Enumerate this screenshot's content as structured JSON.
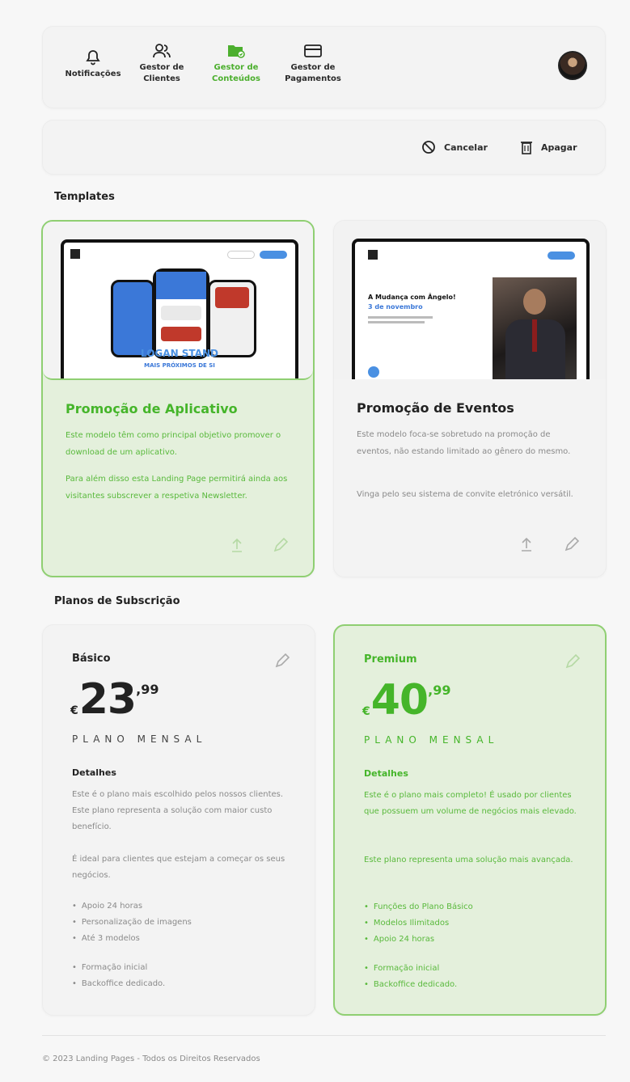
{
  "nav": {
    "items": [
      {
        "label_1": "Notificações",
        "label_2": "",
        "icon": "bell-icon"
      },
      {
        "label_1": "Gestor de",
        "label_2": "Clientes",
        "icon": "users-icon"
      },
      {
        "label_1": "Gestor de",
        "label_2": "Conteúdos",
        "icon": "folder-icon",
        "active": true
      },
      {
        "label_1": "Gestor de",
        "label_2": "Pagamentos",
        "icon": "card-icon"
      }
    ],
    "active_color": "#4caf2e"
  },
  "actions": {
    "cancel": "Cancelar",
    "delete": "Apagar"
  },
  "templates": {
    "title": "Templates",
    "items": [
      {
        "title": "Promoção de Aplicativo",
        "p1": "Este modelo têm como principal objetivo promover o download de um aplicativo.",
        "p2": "Para além disso esta Landing Page permitirá ainda aos visitantes subscrever a respetiva Newsletter.",
        "preview_headline": "LOGAN STAND",
        "preview_sub": "MAIS PRÓXIMOS DE SI",
        "selected": true
      },
      {
        "title": "Promoção de Eventos",
        "p1": "Este modelo foca-se sobretudo na promoção de eventos, não estando limitado ao gênero do mesmo.",
        "p2": "Vinga pelo seu sistema de convite eletrónico versátil.",
        "preview_headline": "A Mudança com Ângelo!",
        "preview_sub": "3 de novembro",
        "selected": false
      }
    ]
  },
  "plans": {
    "title": "Planos de Subscrição",
    "items": [
      {
        "name": "Básico",
        "currency": "€",
        "amount": "23",
        "cents": ",99",
        "period": "PLANO MENSAL",
        "details_title": "Detalhes",
        "p1": "Este é o plano mais escolhido pelos nossos clientes. Este plano representa a solução com maior custo benefício.",
        "p2": "É ideal para clientes que estejam a começar os seus negócios.",
        "features_a": [
          "Apoio 24 horas",
          "Personalização de imagens",
          "Até 3 modelos"
        ],
        "features_b": [
          "Formação inicial",
          "Backoffice dedicado."
        ],
        "selected": false
      },
      {
        "name": "Premium",
        "currency": "€",
        "amount": "40",
        "cents": ",99",
        "period": "PLANO MENSAL",
        "details_title": "Detalhes",
        "p1": "Este é o plano mais completo! É usado por clientes que possuem um volume de negócios mais elevado.",
        "p2": "Este plano representa uma solução mais avançada.",
        "features_a": [
          "Funções do Plano Básico",
          "Modelos Ilimitados",
          "Apoio 24 horas"
        ],
        "features_b": [
          "Formação inicial",
          "Backoffice dedicado."
        ],
        "selected": true
      }
    ]
  },
  "footer": {
    "text": "© 2023 Landing Pages - Todos os Direitos Reservados"
  }
}
